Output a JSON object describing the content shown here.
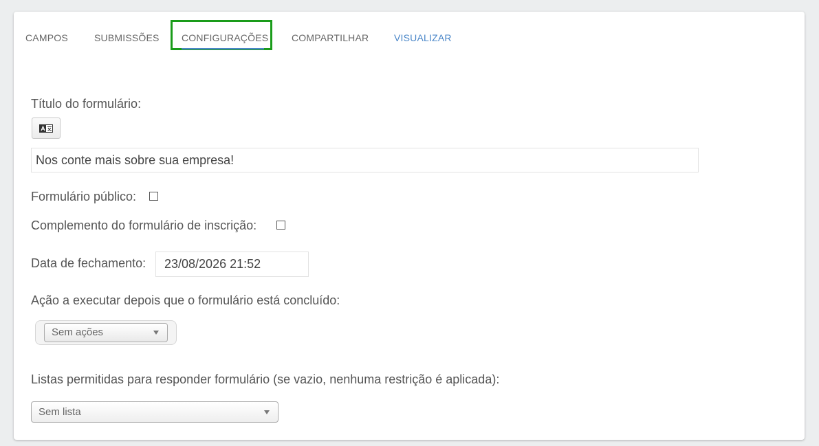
{
  "tabs": [
    {
      "label": "CAMPOS"
    },
    {
      "label": "SUBMISSÕES"
    },
    {
      "label": "CONFIGURAÇÕES",
      "active": true
    },
    {
      "label": "COMPARTILHAR"
    },
    {
      "label": "VISUALIZAR"
    }
  ],
  "colors": {
    "active_frame": "#1a9c1a",
    "tab_link": "#4a86c8",
    "background": "#eceeef"
  },
  "form": {
    "title_label": "Título do formulário:",
    "translate_icon": "translate-icon",
    "title_value": "Nos conte mais sobre sua empresa!",
    "public_label": "Formulário público:",
    "public_checked": false,
    "signup_label": "Complemento do formulário de inscrição:",
    "signup_checked": false,
    "closing_label": "Data de fechamento:",
    "closing_value": "23/08/2026 21:52",
    "action_label": "Ação a executar depois que o formulário está concluído:",
    "action_selected": "Sem ações",
    "lists_label": "Listas permitidas para responder formulário (se vazio, nenhuma restrição é aplicada):",
    "lists_selected": "Sem lista"
  }
}
